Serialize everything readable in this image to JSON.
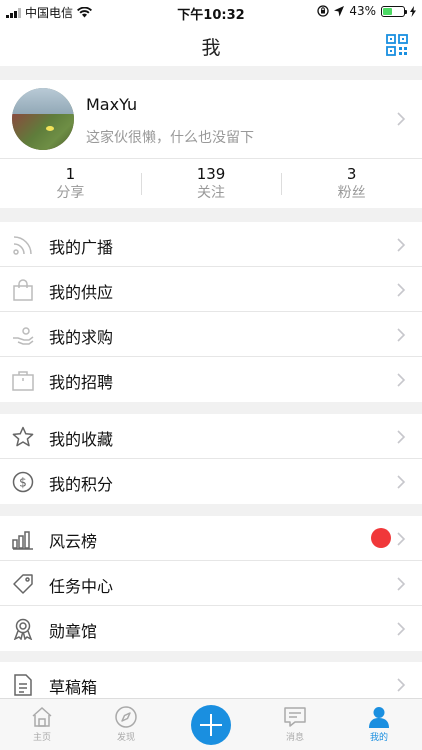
{
  "status_bar": {
    "carrier": "中国电信",
    "time": "下午10:32",
    "battery_percent": "43%",
    "battery_level": 0.43
  },
  "navbar": {
    "title": "我",
    "qr_icon": "qr-code-icon"
  },
  "profile": {
    "name": "MaxYu",
    "bio": "这家伙很懒，什么也没留下",
    "stats": [
      {
        "value": "1",
        "label": "分享"
      },
      {
        "value": "139",
        "label": "关注"
      },
      {
        "value": "3",
        "label": "粉丝"
      }
    ]
  },
  "groups": [
    {
      "items": [
        {
          "label": "我的广播",
          "icon": "broadcast-icon"
        },
        {
          "label": "我的供应",
          "icon": "shopping-bag-icon"
        },
        {
          "label": "我的求购",
          "icon": "hand-request-icon"
        },
        {
          "label": "我的招聘",
          "icon": "briefcase-icon"
        }
      ]
    },
    {
      "items": [
        {
          "label": "我的收藏",
          "icon": "star-icon"
        },
        {
          "label": "我的积分",
          "icon": "dollar-coin-icon"
        }
      ]
    },
    {
      "items": [
        {
          "label": "风云榜",
          "icon": "bar-chart-icon",
          "badge_color": "#f0383a"
        },
        {
          "label": "任务中心",
          "icon": "tag-icon"
        },
        {
          "label": "勋章馆",
          "icon": "medal-icon"
        }
      ]
    },
    {
      "items": [
        {
          "label": "草稿箱",
          "icon": "document-icon"
        }
      ]
    }
  ],
  "tabbar": {
    "tabs": [
      {
        "label": "主页",
        "icon": "home-icon"
      },
      {
        "label": "发现",
        "icon": "compass-icon"
      },
      {
        "label": "",
        "icon": "plus-icon"
      },
      {
        "label": "消息",
        "icon": "message-icon"
      },
      {
        "label": "我的",
        "icon": "user-icon",
        "active": true
      }
    ],
    "accent_color": "#1a8fe0"
  }
}
